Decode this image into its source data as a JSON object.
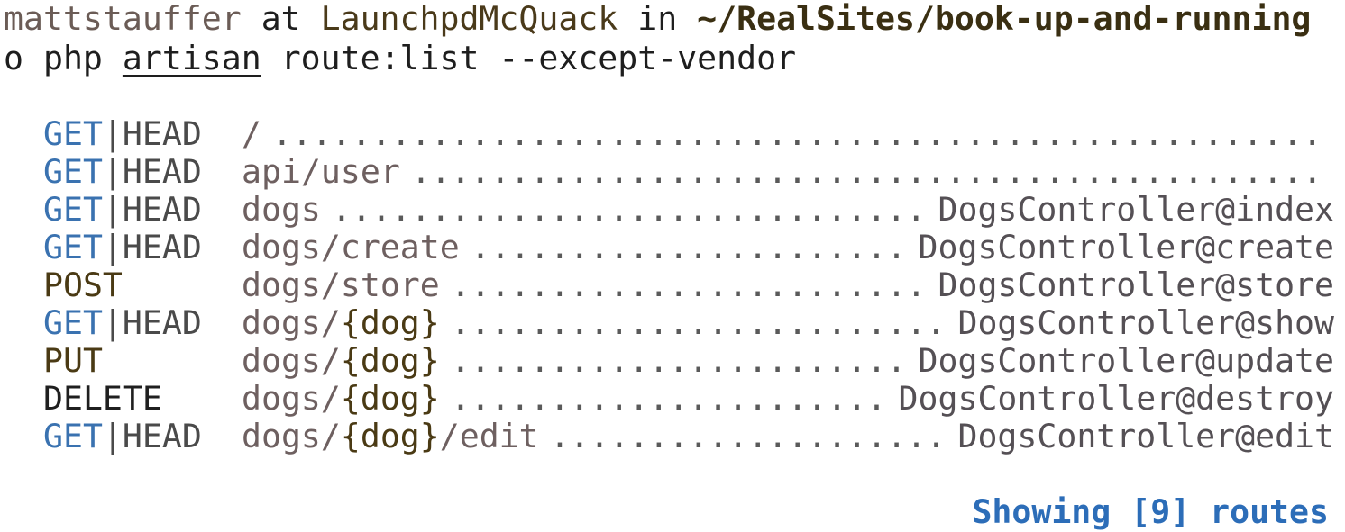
{
  "prompt": {
    "user": "mattstauffer",
    "at": "at",
    "host": "LaunchpdMcQuack",
    "in": "in",
    "path": "~/RealSites/book-up-and-running"
  },
  "command": {
    "symbol": "o",
    "php": "php",
    "artisan": "artisan",
    "rest": "route:list --except-vendor"
  },
  "routes": [
    {
      "get": "GET",
      "sep": "|",
      "head": "HEAD",
      "uri_pre": "/",
      "param": "",
      "uri_post": "",
      "action": ""
    },
    {
      "get": "GET",
      "sep": "|",
      "head": "HEAD",
      "uri_pre": "api/user",
      "param": "",
      "uri_post": "",
      "action": ""
    },
    {
      "get": "GET",
      "sep": "|",
      "head": "HEAD",
      "uri_pre": "dogs",
      "param": "",
      "uri_post": "",
      "action": "DogsController@index"
    },
    {
      "get": "GET",
      "sep": "|",
      "head": "HEAD",
      "uri_pre": "dogs/create",
      "param": "",
      "uri_post": "",
      "action": "DogsController@create"
    },
    {
      "method": "POST",
      "uri_pre": "dogs/store",
      "param": "",
      "uri_post": "",
      "action": "DogsController@store"
    },
    {
      "get": "GET",
      "sep": "|",
      "head": "HEAD",
      "uri_pre": "dogs/",
      "param": "{dog}",
      "uri_post": "",
      "action": "DogsController@show"
    },
    {
      "method": "PUT",
      "uri_pre": "dogs/",
      "param": "{dog}",
      "uri_post": "",
      "action": "DogsController@update"
    },
    {
      "method": "DELETE",
      "uri_pre": "dogs/",
      "param": "{dog}",
      "uri_post": "",
      "action": "DogsController@destroy"
    },
    {
      "get": "GET",
      "sep": "|",
      "head": "HEAD",
      "uri_pre": "dogs/",
      "param": "{dog}",
      "uri_post": "/edit",
      "action": "DogsController@edit"
    }
  ],
  "footer": {
    "text": "Showing [9] routes"
  },
  "colors": {
    "get": "#3a72b0",
    "footer": "#2c6db8",
    "background": "#ffffff"
  }
}
